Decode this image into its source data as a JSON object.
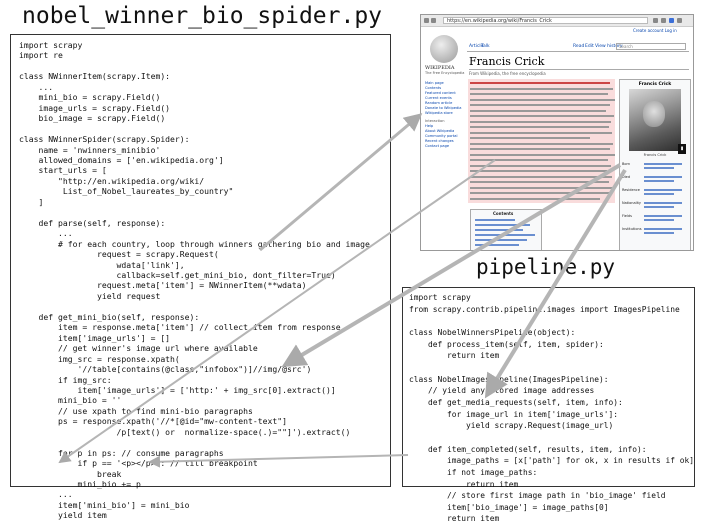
{
  "titles": {
    "spider": "nobel_winner_bio_spider.py",
    "pipeline": "pipeline.py"
  },
  "spider_code": [
    "import scrapy",
    "import re",
    "",
    "class NWinnerItem(scrapy.Item):",
    "    ...",
    "    mini_bio = scrapy.Field()",
    "    image_urls = scrapy.Field()",
    "    bio_image = scrapy.Field()",
    "",
    "class NWinnerSpider(scrapy.Spider):",
    "    name = 'nwinners_minibio'",
    "    allowed_domains = ['en.wikipedia.org']",
    "    start_urls = [",
    "        \"http://en.wikipedia.org/wiki/",
    "         List_of_Nobel_laureates_by_country\"",
    "    ]",
    "",
    "    def parse(self, response):",
    "        ...",
    "        # for each country, loop through winners gathering bio and image",
    "                request = scrapy.Request(",
    "                    wdata['link'],",
    "                    callback=self.get_mini_bio, dont_filter=True)",
    "                request.meta['item'] = NWinnerItem(**wdata)",
    "                yield request",
    "",
    "    def get_mini_bio(self, response):",
    "        item = response.meta['item'] // collect item from response",
    "        item['image_urls'] = []",
    "        // get winner's image url where available",
    "        img_src = response.xpath(",
    "            '//table[contains(@class,\"infobox\")]//img/@src')",
    "        if img_src:",
    "            item['image_urls'] = ['http:' + img_src[0].extract()]",
    "        mini_bio = ''",
    "        // use xpath to find mini-bio paragraphs",
    "        ps = response.xpath('//*[@id=\"mw-content-text\"]",
    "                    /p[text() or  normalize-space(.)=\"\"]').extract()",
    "",
    "        for p in ps: // consume paragraphs",
    "            if p == '<p></p>': // till breakpoint",
    "                break",
    "            mini_bio += p",
    "        ...",
    "        item['mini_bio'] = mini_bio",
    "        yield item"
  ],
  "pipeline_code": [
    "import scrapy",
    "from scrapy.contrib.pipeline.images import ImagesPipeline",
    "",
    "class NobelWinnersPipeline(object):",
    "    def process_item(self, item, spider):",
    "        return item",
    "",
    "class NobelImagesPipeline(ImagesPipeline):",
    "    // yield any stored image addresses",
    "    def get_media_requests(self, item, info):",
    "        for image_url in item['image_urls']:",
    "            yield scrapy.Request(image_url)",
    "",
    "    def item_completed(self, results, item, info):",
    "        image_paths = [x['path'] for ok, x in results if ok]",
    "        if not image_paths:",
    "            return item",
    "        // store first image path in 'bio_image' field",
    "        item['bio_image'] = image_paths[0]",
    "        return item"
  ],
  "screenshot": {
    "url": "https://en.wikipedia.org/wiki/Francis_Crick",
    "wordmark": "WIKIPEDIA",
    "tagline": "The Free Encyclopedia",
    "article_title": "Francis Crick",
    "from_line": "From Wikipedia, the free encyclopedia",
    "tabs": {
      "article": "Article",
      "talk": "Talk",
      "read": "Read",
      "edit": "Edit",
      "history": "View history"
    },
    "search_placeholder": "Search",
    "user_links": "Create account  Log in",
    "sidebar": [
      "Main page",
      "Contents",
      "Featured content",
      "Current events",
      "Random article",
      "Donate to Wikipedia",
      "Wikipedia store"
    ],
    "sidebar_head": "Interaction",
    "sidebar2": [
      "Help",
      "About Wikipedia",
      "Community portal",
      "Recent changes",
      "Contact page"
    ],
    "toc_title": "Contents",
    "infobox_name": "Francis Crick",
    "infobox_caption": "Francis Crick",
    "infobox_rows": [
      "Born",
      "Died",
      "Residence",
      "Nationality",
      "Fields",
      "Institutions"
    ]
  }
}
